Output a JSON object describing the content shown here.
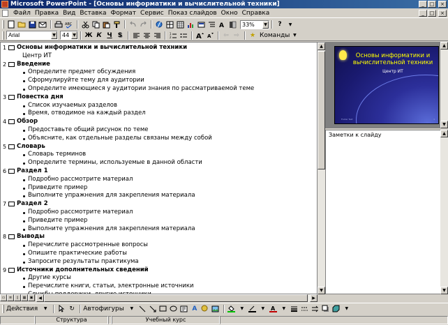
{
  "window": {
    "title": "Microsoft PowerPoint - [Основы информатики и вычислительной техники]",
    "buttons": [
      "_",
      "□",
      "×"
    ]
  },
  "menu": {
    "items": [
      "Файл",
      "Правка",
      "Вид",
      "Вставка",
      "Формат",
      "Сервис",
      "Показ слайдов",
      "Окно",
      "Справка"
    ]
  },
  "toolbar_standard": {
    "zoom": "33%",
    "help_icon": "?"
  },
  "toolbar_formatting": {
    "font": "Arial",
    "font_size": "44",
    "bold": "Ж",
    "italic": "К",
    "underline": "Ч",
    "shadow": "S",
    "commands_label": "Команды"
  },
  "outline": {
    "slides": [
      {
        "num": "1",
        "title": "Основы информатики и вычислительной техники",
        "subtitle": "Центр ИТ",
        "bullets": []
      },
      {
        "num": "2",
        "title": "Введение",
        "bullets": [
          "Определите предмет обсуждения",
          "Сформулируйте тему для аудитории",
          "Определите имеющиеся у аудитории знания по рассматриваемой теме"
        ]
      },
      {
        "num": "3",
        "title": "Повестка дня",
        "bullets": [
          "Список изучаемых разделов",
          "Время, отводимое на каждый раздел"
        ]
      },
      {
        "num": "4",
        "title": "Обзор",
        "bullets": [
          "Предоставьте общий рисунок по теме",
          "Объясните, как отдельные разделы связаны между собой"
        ]
      },
      {
        "num": "5",
        "title": "Словарь",
        "bullets": [
          "Словарь терминов",
          "Определите термины, используемые в данной области"
        ]
      },
      {
        "num": "6",
        "title": "Раздел 1",
        "bullets": [
          "Подробно рассмотрите материал",
          "Приведите пример",
          "Выполните упражнения для закрепления материала"
        ]
      },
      {
        "num": "7",
        "title": "Раздел 2",
        "bullets": [
          "Подробно рассмотрите материал",
          "Приведите пример",
          "Выполните упражнения для закрепления материала"
        ]
      },
      {
        "num": "8",
        "title": "Выводы",
        "bullets": [
          "Перечислите рассмотренные вопросы",
          "Опишите практические работы",
          "Запросите результаты практикума"
        ]
      },
      {
        "num": "9",
        "title": "Источники дополнительных сведений",
        "bullets": [
          "Другие курсы",
          "Перечислите книги, статьи, электронные источники",
          "Службы поддержки, другие источники"
        ]
      }
    ]
  },
  "preview": {
    "title": "Основы информатики и вычислительной техники",
    "subtitle": "Центр ИТ",
    "footer": "Footer Text",
    "page": "1"
  },
  "notes": {
    "label": "Заметки к слайду"
  },
  "drawing": {
    "actions_label": "Действия",
    "autoshapes_label": "Автофигуры"
  },
  "status": {
    "cells": [
      "",
      "Структура",
      "",
      "Учебный курс",
      ""
    ]
  },
  "colors": {
    "title_bar": "#0a246a",
    "slide_bg": "#1a1a70",
    "slide_title": "#ffff00"
  }
}
